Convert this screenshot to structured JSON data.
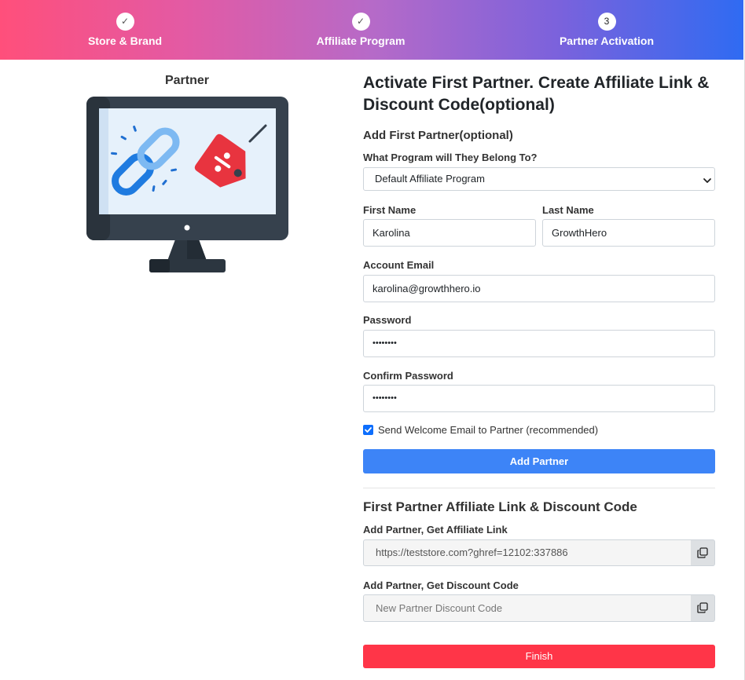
{
  "stepper": {
    "steps": [
      {
        "marker": "✓",
        "label": "Store & Brand"
      },
      {
        "marker": "✓",
        "label": "Affiliate Program"
      },
      {
        "marker": "3",
        "label": "Partner Activation"
      }
    ]
  },
  "left": {
    "title": "Partner",
    "illustration_icons": [
      "monitor-icon",
      "chain-link-icon",
      "discount-tag-icon"
    ]
  },
  "form": {
    "title": "Activate First Partner. Create Affiliate Link & Discount Code(optional)",
    "subheading": "Add First Partner(optional)",
    "program_label": "What Program will They Belong To?",
    "program_value": "Default Affiliate Program",
    "first_name_label": "First Name",
    "first_name_value": "Karolina",
    "last_name_label": "Last Name",
    "last_name_value": "GrowthHero",
    "email_label": "Account Email",
    "email_value": "karolina@growthhero.io",
    "password_label": "Password",
    "password_value": "••••••••",
    "confirm_label": "Confirm Password",
    "confirm_value": "••••••••",
    "welcome_checkbox_label": "Send Welcome Email to Partner (recommended)",
    "welcome_checked": true,
    "add_partner_button": "Add Partner"
  },
  "links": {
    "section_title": "First Partner Affiliate Link & Discount Code",
    "affiliate_label": "Add Partner, Get Affiliate Link",
    "affiliate_value": "https://teststore.com?ghref=12102:337886",
    "discount_label": "Add Partner, Get Discount Code",
    "discount_placeholder": "New Partner Discount Code",
    "finish_button": "Finish"
  },
  "colors": {
    "primary_blue": "#3d84f7",
    "finish_red": "#ff3548",
    "gradient_start": "#ff4f7b",
    "gradient_end": "#2f6bf2"
  }
}
